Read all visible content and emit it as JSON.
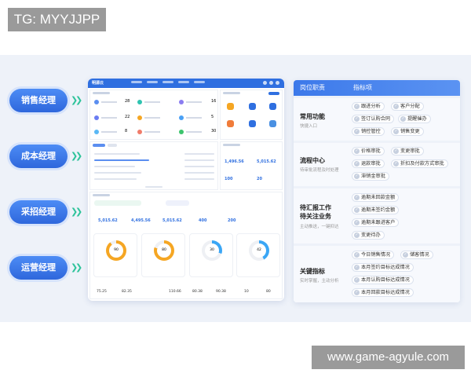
{
  "overlay": {
    "tag": "TG: MYYJJPP",
    "watermark": "www.game-agyule.com"
  },
  "roles": [
    {
      "label": "销售经理"
    },
    {
      "label": "成本经理"
    },
    {
      "label": "采招经理"
    },
    {
      "label": "运营经理"
    }
  ],
  "colors": {
    "accent": "#2f6fe0",
    "arrow": "#2fc39b",
    "band": "#eef2f9"
  },
  "dashboard": {
    "logo": "明源云",
    "stats": [
      "28",
      "16",
      "22",
      "5",
      "8",
      "30"
    ],
    "kpis": [
      "1,496.56",
      "5,015.62",
      "100",
      "20"
    ],
    "cards": [
      "5,015.62",
      "4,495.56",
      "5,015.62",
      "400",
      "200"
    ],
    "rings": [
      "90",
      "80",
      "30",
      "42"
    ],
    "ring_vals": [
      "75.25",
      "82.35",
      "110.66",
      "80.38",
      "90.38",
      "10",
      "80"
    ]
  },
  "table": {
    "headers": [
      "岗位职责",
      "指标项"
    ],
    "rows": [
      {
        "title": "常用功能",
        "sub": "快捷入口",
        "chips": [
          "跟进分析",
          "客户分配",
          "签订认购合同",
          "提醒催办",
          "销控管控",
          "销售变更"
        ]
      },
      {
        "title": "流程中心",
        "sub": "待审批流程及时处理",
        "chips": [
          "价格审批",
          "变更审批",
          "退款审批",
          "折扣及付款方式审批",
          "滞销金审批"
        ]
      },
      {
        "title": "待汇报工作\n待关注业务",
        "sub": "主动推送，一键抑达",
        "chips": [
          "逾期未回款金额",
          "逾期未签约金额",
          "逾期未跟进客户",
          "变更待办"
        ]
      },
      {
        "title": "关键指标",
        "sub": "实时掌握，主动分析",
        "chips": [
          "今日销售情况",
          "储客情况",
          "本月签约目标达成情况",
          "本月认购目标达成情况",
          "本月回款目标达成情况"
        ]
      }
    ]
  }
}
